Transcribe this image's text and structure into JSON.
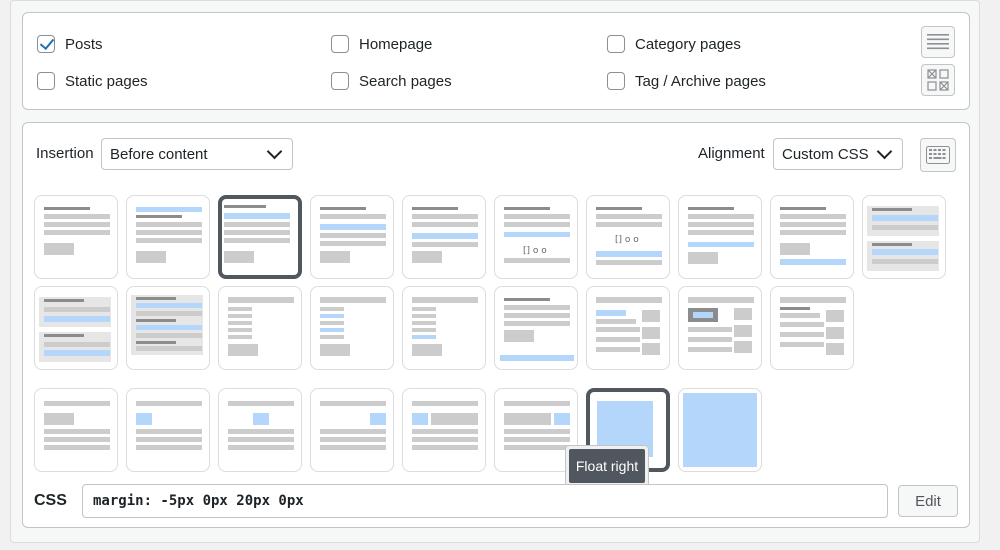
{
  "targets": {
    "items": [
      {
        "label": "Posts",
        "checked": true
      },
      {
        "label": "Homepage",
        "checked": false
      },
      {
        "label": "Category pages",
        "checked": false
      },
      {
        "label": "Static pages",
        "checked": false
      },
      {
        "label": "Search pages",
        "checked": false
      },
      {
        "label": "Tag / Archive pages",
        "checked": false
      }
    ],
    "icons": [
      "list-view-icon",
      "grid-view-icon"
    ]
  },
  "settings": {
    "insertion_label": "Insertion",
    "insertion_value": "Before content",
    "alignment_label": "Alignment",
    "alignment_value": "Custom CSS",
    "keyboard_icon": "keyboard-icon"
  },
  "tooltip": {
    "text": "Float right"
  },
  "css": {
    "label": "CSS",
    "value": "margin: -5px 0px 20px 0px",
    "edit_label": "Edit"
  },
  "colors": {
    "highlight": "#b5d6fb",
    "gray": "#cccccc",
    "dark": "#8c8c8c"
  }
}
